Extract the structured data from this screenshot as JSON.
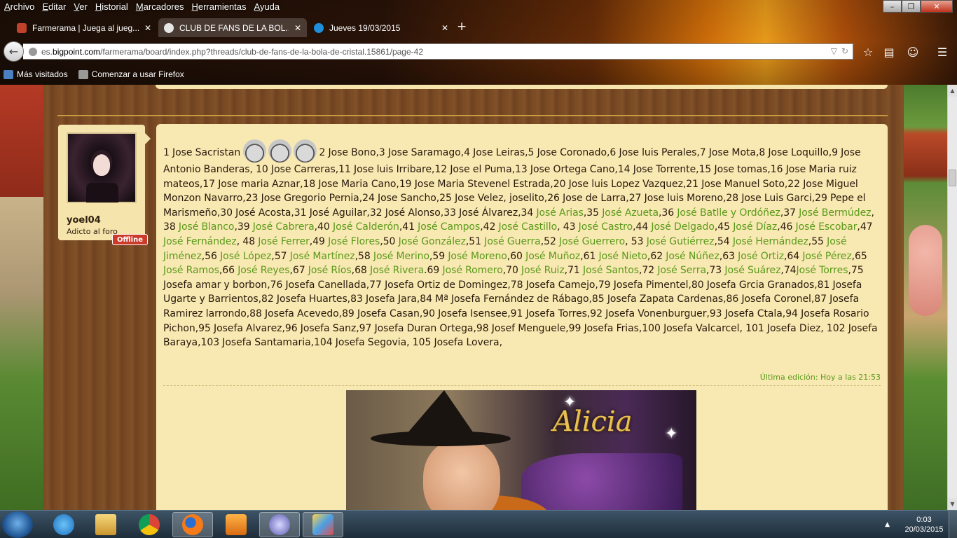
{
  "menubar": {
    "items": [
      "Archivo",
      "Editar",
      "Ver",
      "Historial",
      "Marcadores",
      "Herramientas",
      "Ayuda"
    ]
  },
  "window_controls": {
    "minimize": "–",
    "maximize": "❐",
    "close": "✕"
  },
  "tabs": [
    {
      "title": "Farmerama | Juega al jueg...",
      "close": "✕"
    },
    {
      "title": "CLUB DE FANS DE LA BOL...",
      "close": "✕"
    },
    {
      "title": "Jueves 19/03/2015",
      "close": "✕"
    }
  ],
  "new_tab_label": "+",
  "urlbar": {
    "prefix": "es.",
    "host": "bigpoint.com",
    "path": "/farmerama/board/index.php?threads/club-de-fans-de-la-bola-de-cristal.15861/page-42"
  },
  "bookmarks": [
    {
      "label": "Más visitados"
    },
    {
      "label": "Comenzar a usar Firefox"
    }
  ],
  "post": {
    "user": {
      "name": "yoel04",
      "title": "Adicto al foro",
      "status": "Offline"
    },
    "last_edit": "Última edición: Hoy a las 21:53",
    "image_title": "Alicia",
    "intro": "1 Jose Sacristan",
    "text_a": "2 Jose Bono,3 Jose Saramago,4 Jose Leiras,5 Jose Coronado,6 Jose luis Perales,7 Jose Mota,8 Jose Loquillo,9 Jose Antonio Banderas, 10 Jose Carreras,11 Jose luis Irribare,12 Jose el Puma,13 Jose Ortega Cano,14 Jose Torrente,15 Jose tomas,16 Jose Maria ruiz mateos,17 Jose maria Aznar,18 Jose Maria Cano,19 Jose Maria Stevenel Estrada,20 Jose luis Lopez Vazquez,21 Jose Manuel Soto,22 Jose Miguel Monzon Navarro,23 Jose Gregorio Pernia,24 Jose Sancho,25 Jose Velez, joselito,26 Jose de Larra,27 Jose luis Moreno,28 Jose Luis Garci,29 Pepe el Marismeño,30 José Acosta,31 José Aguilar,32 José Alonso,33 José Álvarez,34 ",
    "links": [
      {
        "pre": "",
        "name": "José Arias"
      },
      {
        "pre": ",35 ",
        "name": "José Azueta"
      },
      {
        "pre": ",36 ",
        "name": "José Batlle y Ordóñez"
      },
      {
        "pre": ",37 ",
        "name": "José Bermúdez"
      },
      {
        "pre": ", 38 ",
        "name": "José Blanco"
      },
      {
        "pre": ",39 ",
        "name": "José Cabrera"
      },
      {
        "pre": ",40 ",
        "name": "José Calderón"
      },
      {
        "pre": ",41 ",
        "name": "José Campos"
      },
      {
        "pre": ",42 ",
        "name": "José Castillo"
      },
      {
        "pre": ", 43 ",
        "name": "José Castro"
      },
      {
        "pre": ",44 ",
        "name": "José Delgado"
      },
      {
        "pre": ",45 ",
        "name": "José Díaz"
      },
      {
        "pre": ",46 ",
        "name": "José Escobar"
      },
      {
        "pre": ",47 ",
        "name": "José Fernández"
      },
      {
        "pre": ", 48 ",
        "name": "José Ferrer"
      },
      {
        "pre": ",49 ",
        "name": "José Flores"
      },
      {
        "pre": ",50 ",
        "name": "José González"
      },
      {
        "pre": ",51 ",
        "name": "José Guerra"
      },
      {
        "pre": ",52 ",
        "name": "José Guerrero"
      },
      {
        "pre": ", 53 ",
        "name": "José Gutiérrez"
      },
      {
        "pre": ",54 ",
        "name": "José Hernández"
      },
      {
        "pre": ",55 ",
        "name": "José Jiménez"
      },
      {
        "pre": ",56 ",
        "name": "José López"
      },
      {
        "pre": ",57 ",
        "name": "José Martínez"
      },
      {
        "pre": ",58 ",
        "name": "José Merino"
      },
      {
        "pre": ",59 ",
        "name": "José Moreno"
      },
      {
        "pre": ",60 ",
        "name": "José Muñoz"
      },
      {
        "pre": ",61 ",
        "name": "José Nieto"
      },
      {
        "pre": ",62 ",
        "name": "José Núñez"
      },
      {
        "pre": ",63 ",
        "name": "José Ortiz"
      },
      {
        "pre": ",64 ",
        "name": "José Pérez"
      },
      {
        "pre": ",65 ",
        "name": "José Ramos"
      },
      {
        "pre": ",66 ",
        "name": "José Reyes"
      },
      {
        "pre": ",67 ",
        "name": "José Ríos"
      },
      {
        "pre": ",68 ",
        "name": "José Rivera"
      },
      {
        "pre": ".69 ",
        "name": "José Romero"
      },
      {
        "pre": ",70 ",
        "name": "José Ruiz"
      },
      {
        "pre": ",71 ",
        "name": "José Santos"
      },
      {
        "pre": ",72 ",
        "name": "José Serra"
      },
      {
        "pre": ",73 ",
        "name": "José Suárez"
      },
      {
        "pre": ",74",
        "name": "José Torres"
      }
    ],
    "text_b": ",75 Josefa amar y borbon,76 Josefa Canellada,77 Josefa Ortiz de Domingez,78 Josefa Camejo,79 Josefa Pimentel,80 Josefa Grcia Granados,81 Josefa Ugarte y Barrientos,82 Josefa Huartes,83 Josefa Jara,84 Mª Josefa Fernández de Rábago,85 Josefa Zapata Cardenas,86 Josefa Coronel,87 Josefa Ramirez larrondo,88 Josefa Acevedo,89 Josefa Casan,90 Josefa Isensee,91 Josefa Torres,92 Josefa Vonenburguer,93 Josefa Ctala,94 Josefa Rosario Pichon,95 Josefa Alvarez,96 Josefa Sanz,97 Josefa Duran Ortega,98 Josef Menguele,99 Josefa Frias,100 Josefa Valcarcel, 101 Josefa Diez, 102 Josefa Baraya,103 Josefa Santamaria,104 Josefa Segovia, 105 Josefa Lovera,"
  },
  "taskbar": {
    "time": "0:03",
    "date": "20/03/2015"
  },
  "colors": {
    "link": "#5a9a1a",
    "post_bg": "#f8e8b2",
    "offline": "#cc3a2a"
  }
}
